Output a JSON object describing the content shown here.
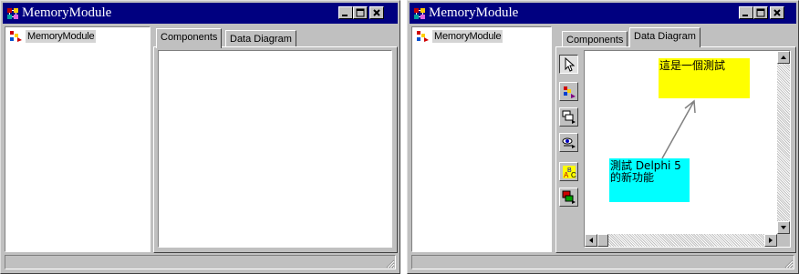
{
  "left_window": {
    "title": "MemoryModule",
    "tree": {
      "items": [
        {
          "label": "MemoryModule"
        }
      ]
    },
    "tabs": [
      {
        "label": "Components",
        "active": true
      },
      {
        "label": "Data Diagram",
        "active": false
      }
    ]
  },
  "right_window": {
    "title": "MemoryModule",
    "tree": {
      "items": [
        {
          "label": "MemoryModule"
        }
      ]
    },
    "tabs": [
      {
        "label": "Components",
        "active": false
      },
      {
        "label": "Data Diagram",
        "active": true
      }
    ],
    "diagram": {
      "notes": [
        {
          "text": "這是一個測試",
          "color": "#ffff00"
        },
        {
          "text": "測試 Delphi 5 的新功能",
          "color": "#00ffff"
        }
      ],
      "toolbar": [
        {
          "icon": "pointer-arrow-icon",
          "pressed": true
        },
        {
          "icon": "property-link-icon",
          "pressed": false
        },
        {
          "icon": "master-detail-icon",
          "pressed": false
        },
        {
          "icon": "lookup-icon",
          "pressed": false
        },
        {
          "icon": "comment-block-icon",
          "pressed": false
        },
        {
          "icon": "comment-allude-icon",
          "pressed": false
        }
      ]
    }
  },
  "colors": {
    "titlebar": "#000080",
    "window_face": "#c0c0c0",
    "note_yellow": "#ffff00",
    "note_cyan": "#00ffff"
  }
}
